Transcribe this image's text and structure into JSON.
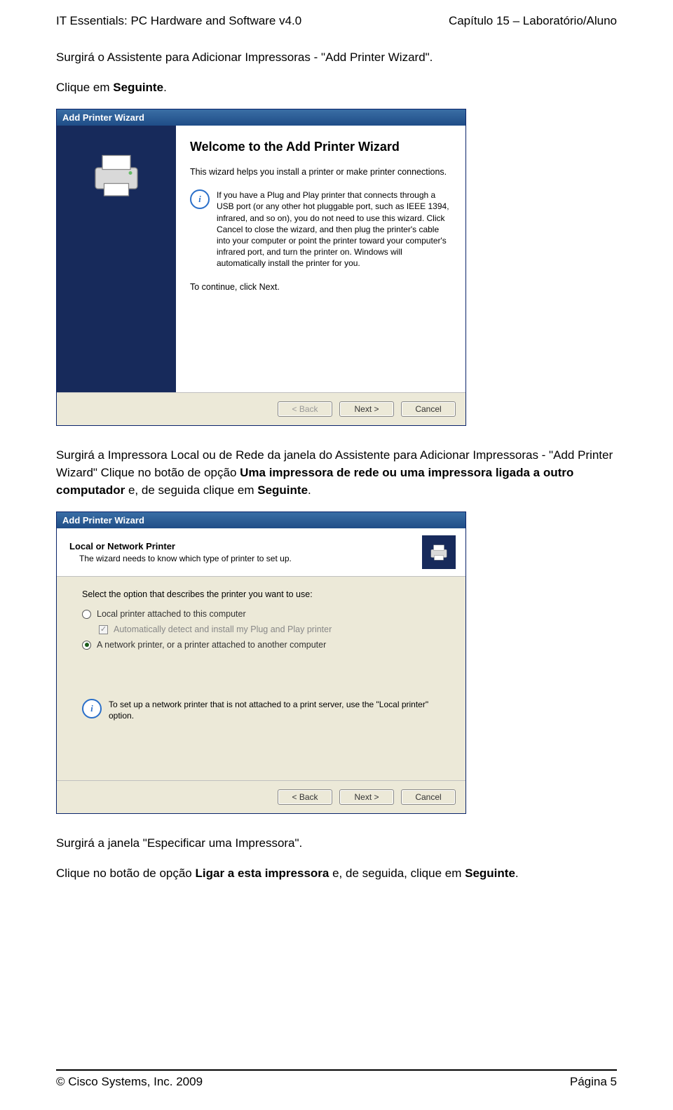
{
  "header": {
    "left": "IT Essentials: PC Hardware and Software v4.0",
    "right": "Capítulo 15 – Laboratório/Aluno"
  },
  "para1_a": "Surgirá o Assistente para Adicionar Impressoras - \"Add Printer Wizard\".",
  "para1_b_prefix": "Clique em ",
  "para1_b_bold": "Seguinte",
  "para1_b_suffix": ".",
  "wizard1": {
    "title": "Add Printer Wizard",
    "welcome": "Welcome to the Add Printer Wizard",
    "sub": "This wizard helps you install a printer or make printer connections.",
    "info": "If you have a Plug and Play printer that connects through a USB port (or any other hot pluggable port, such as IEEE 1394, infrared, and so on), you do not need to use this wizard. Click Cancel to close the wizard, and then plug the printer's cable into your computer or point the printer toward your computer's infrared port, and turn the printer on. Windows will automatically install the printer for you.",
    "continue": "To continue, click Next.",
    "btn_back": "< Back",
    "btn_next": "Next >",
    "btn_cancel": "Cancel"
  },
  "para2_a": "Surgirá a Impressora Local ou de Rede da janela do Assistente para Adicionar Impressoras - \"Add Printer Wizard\" Clique no botão de opção ",
  "para2_bold1": "Uma impressora de rede ou uma impressora ligada a outro computador",
  "para2_b": " e, de seguida clique em ",
  "para2_bold2": "Seguinte",
  "para2_c": ".",
  "wizard2": {
    "title": "Add Printer Wizard",
    "head_title": "Local or Network Printer",
    "head_sub": "The wizard needs to know which type of printer to set up.",
    "prompt": "Select the option that describes the printer you want to use:",
    "opt_local": "Local printer attached to this computer",
    "opt_auto": "Automatically detect and install my Plug and Play printer",
    "opt_network": "A network printer, or a printer attached to another computer",
    "tip": "To set up a network printer that is not attached to a print server, use the \"Local printer\" option.",
    "btn_back": "< Back",
    "btn_next": "Next >",
    "btn_cancel": "Cancel"
  },
  "para3": "Surgirá a janela \"Especificar uma Impressora\".",
  "para4_a": "Clique no botão de opção ",
  "para4_bold": "Ligar a esta impressora",
  "para4_b": " e, de seguida, clique em ",
  "para4_bold2": "Seguinte",
  "para4_c": ".",
  "footer": {
    "left": "© Cisco Systems, Inc. 2009",
    "right": "Página 5"
  }
}
